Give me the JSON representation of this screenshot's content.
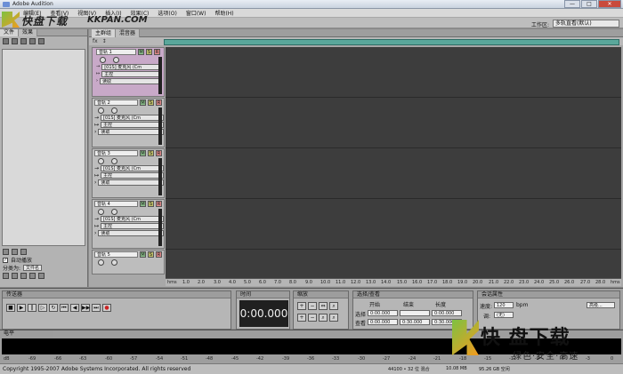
{
  "window": {
    "title": "Adobe Audition",
    "btn_min": "—",
    "btn_max": "□",
    "btn_close": "✕"
  },
  "menubar": [
    "编辑(E)",
    "查看(V)",
    "视图(V)",
    "插入(I)",
    "效果(C)",
    "选项(O)",
    "窗口(W)",
    "帮助(H)"
  ],
  "watermark_top": {
    "text": "快盘下载",
    "url": "KKPAN.COM"
  },
  "workspace": {
    "label": "工作区:",
    "value": "多轨直看(默认)"
  },
  "left_panel": {
    "tabs": [
      "文件",
      "效果"
    ],
    "auto_play_label": "自动播放",
    "sort_label": "分类为:",
    "sort_value": "文件名"
  },
  "main": {
    "tabs": [
      "主群组",
      "混音器"
    ],
    "toolbar_icons": [
      "fx",
      "↕"
    ],
    "tracks": [
      {
        "name": "音轨 1",
        "input": "[01S] 麦克风 (Cm",
        "output": "主控",
        "mode": "读取"
      },
      {
        "name": "音轨 2",
        "input": "[01S] 麦克风 (Cm",
        "output": "主控",
        "mode": "读取"
      },
      {
        "name": "音轨 3",
        "input": "[01S] 麦克风 (Cm",
        "output": "主控",
        "mode": "读取"
      },
      {
        "name": "音轨 4",
        "input": "[01S] 麦克风 (Cm",
        "output": "主控",
        "mode": "读取"
      },
      {
        "name": "音轨 5",
        "input": "",
        "output": "",
        "mode": ""
      }
    ],
    "track_buttons": [
      "M",
      "S",
      "R"
    ],
    "ruler_ticks": [
      "hms",
      "1.0",
      "2.0",
      "3.0",
      "4.0",
      "5.0",
      "6.0",
      "7.0",
      "8.0",
      "9.0",
      "10.0",
      "11.0",
      "12.0",
      "13.0",
      "14.0",
      "15.0",
      "16.0",
      "17.0",
      "18.0",
      "19.0",
      "20.0",
      "21.0",
      "22.0",
      "23.0",
      "24.0",
      "25.0",
      "26.0",
      "27.0",
      "28.0",
      "hms"
    ]
  },
  "transport": {
    "title": "传送器"
  },
  "time": {
    "title": "时间",
    "value": "0:00.000"
  },
  "zoom": {
    "title": "缩放"
  },
  "selection": {
    "title": "选择/查看",
    "headers": [
      "开始",
      "结束",
      "长度"
    ],
    "rows": [
      {
        "label": "选择",
        "values": [
          "0:00.000",
          "",
          "0:00.000"
        ]
      },
      {
        "label": "查看",
        "values": [
          "0:00.000",
          "0:30.000",
          "0:30.000"
        ]
      }
    ]
  },
  "session": {
    "title": "会话属性",
    "tempo_label": "速度:",
    "tempo_value": "120",
    "tempo_unit": "bpm",
    "advanced": "高级...",
    "key_label": "调:",
    "key_value": "(无)"
  },
  "meter": {
    "title": "电平",
    "scale": [
      "dB",
      "-69",
      "-66",
      "-63",
      "-60",
      "-57",
      "-54",
      "-51",
      "-48",
      "-45",
      "-42",
      "-39",
      "-36",
      "-33",
      "-30",
      "-27",
      "-24",
      "-21",
      "-18",
      "-15",
      "-12",
      "-9",
      "-6",
      "-3",
      "0"
    ]
  },
  "status": {
    "copyright": "Copyright 1995-2007 Adobe Systems Incorporated. All rights reserved",
    "format": "44100 • 32 位 混合",
    "size": "10.08 MB",
    "free": "95.26 GB 空闲"
  },
  "watermark_bottom": {
    "big": "快 盘下载",
    "small": "绿色·安全·高速"
  }
}
